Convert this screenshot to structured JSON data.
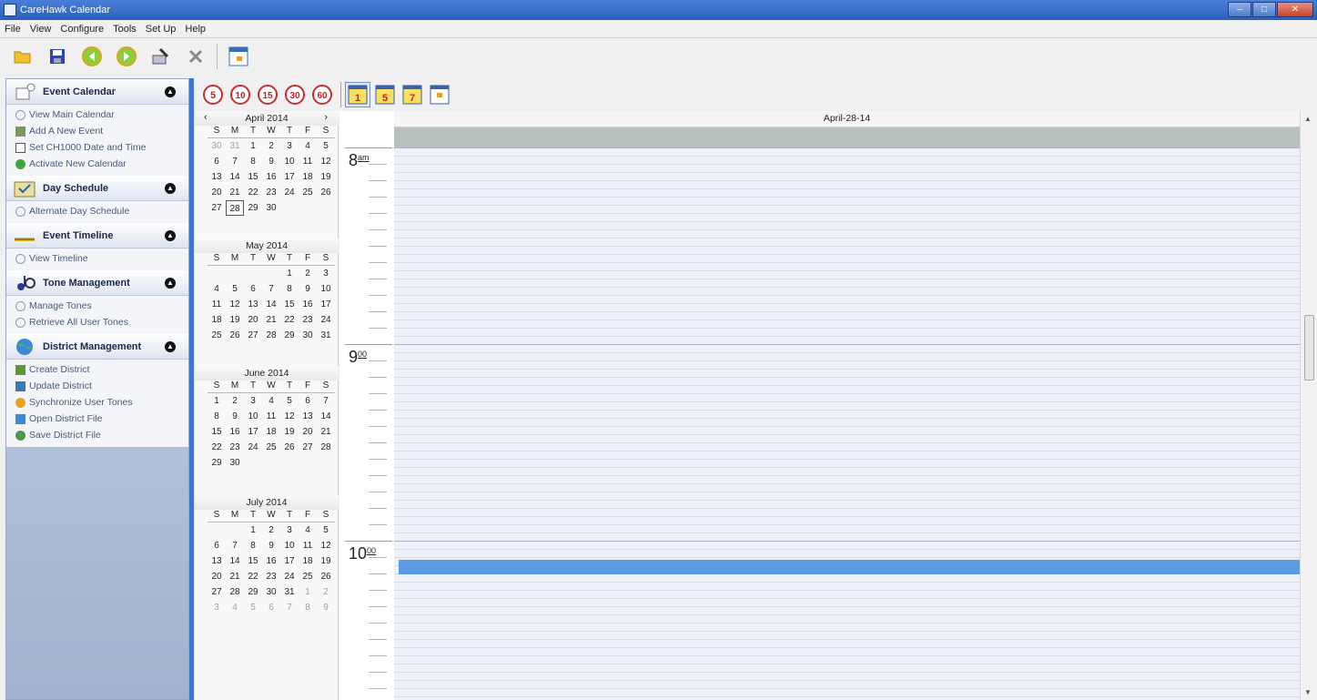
{
  "window": {
    "title": "CareHawk Calendar",
    "minimize": "–",
    "maximize": "□",
    "close": "✕"
  },
  "menu": [
    "File",
    "View",
    "Configure",
    "Tools",
    "Set Up",
    "Help"
  ],
  "toolbar": {
    "buttons": [
      "open-folder-icon",
      "save-icon",
      "back-icon",
      "forward-icon",
      "tool-icon",
      "delete-icon",
      "calendar-icon"
    ]
  },
  "nav": {
    "event_calendar": {
      "title": "Event Calendar",
      "items": [
        "View Main Calendar",
        "Add A New Event",
        "Set CH1000 Date and Time",
        "Activate New Calendar"
      ]
    },
    "day_schedule": {
      "title": "Day Schedule",
      "items": [
        "Alternate Day Schedule"
      ]
    },
    "event_timeline": {
      "title": "Event Timeline",
      "items": [
        "View Timeline"
      ]
    },
    "tone_management": {
      "title": "Tone Management",
      "items": [
        "Manage Tones",
        "Retrieve All User Tones"
      ]
    },
    "district_management": {
      "title": "District Management",
      "items": [
        "Create District",
        "Update District",
        "Synchronize User Tones",
        "Open District File",
        "Save District File"
      ]
    }
  },
  "intervals": [
    "5",
    "10",
    "15",
    "30",
    "60"
  ],
  "views": [
    "1",
    "5",
    "7",
    "month"
  ],
  "minical": {
    "prev": "‹",
    "next": "›",
    "dow": [
      "S",
      "M",
      "T",
      "W",
      "T",
      "F",
      "S"
    ],
    "months": [
      {
        "name": "April 2014",
        "days": [
          "30",
          "31",
          "1",
          "2",
          "3",
          "4",
          "5",
          "6",
          "7",
          "8",
          "9",
          "10",
          "11",
          "12",
          "13",
          "14",
          "15",
          "16",
          "17",
          "18",
          "19",
          "20",
          "21",
          "22",
          "23",
          "24",
          "25",
          "26",
          "27",
          "28",
          "29",
          "30"
        ],
        "leading_other": 2,
        "today": "28"
      },
      {
        "name": "May 2014",
        "days": [
          "",
          "",
          "",
          "",
          "1",
          "2",
          "3",
          "4",
          "5",
          "6",
          "7",
          "8",
          "9",
          "10",
          "11",
          "12",
          "13",
          "14",
          "15",
          "16",
          "17",
          "18",
          "19",
          "20",
          "21",
          "22",
          "23",
          "24",
          "25",
          "26",
          "27",
          "28",
          "29",
          "30",
          "31"
        ],
        "leading_other": 0
      },
      {
        "name": "June 2014",
        "days": [
          "1",
          "2",
          "3",
          "4",
          "5",
          "6",
          "7",
          "8",
          "9",
          "10",
          "11",
          "12",
          "13",
          "14",
          "15",
          "16",
          "17",
          "18",
          "19",
          "20",
          "21",
          "22",
          "23",
          "24",
          "25",
          "26",
          "27",
          "28",
          "29",
          "30"
        ],
        "leading_other": 0
      },
      {
        "name": "July 2014",
        "days": [
          "",
          "",
          "1",
          "2",
          "3",
          "4",
          "5",
          "6",
          "7",
          "8",
          "9",
          "10",
          "11",
          "12",
          "13",
          "14",
          "15",
          "16",
          "17",
          "18",
          "19",
          "20",
          "21",
          "22",
          "23",
          "24",
          "25",
          "26",
          "27",
          "28",
          "29",
          "30",
          "31",
          "1",
          "2",
          "3",
          "4",
          "5",
          "6",
          "7",
          "8",
          "9"
        ],
        "leading_other": 0,
        "trailing_other": 9
      }
    ]
  },
  "dayview": {
    "date_header": "April-28-14",
    "hours": [
      {
        "h": "8",
        "m": "am"
      },
      {
        "h": "9",
        "m": "00"
      },
      {
        "h": "10",
        "m": "00"
      }
    ]
  }
}
